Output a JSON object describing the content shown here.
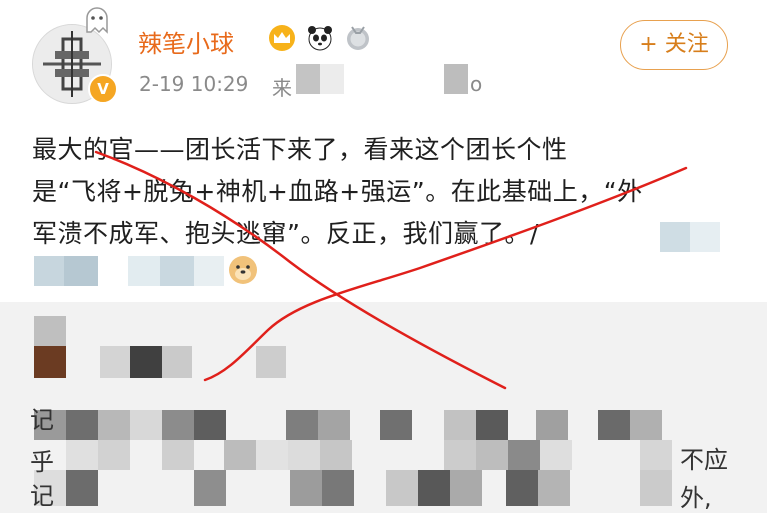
{
  "post": {
    "username": "辣笔小球",
    "timestamp": "2-19 10:29",
    "source_prefix": "来",
    "source_suffix": "o",
    "follow_label": "+ 关注",
    "content_lines": [
      "最大的官——团长活下来了，看来这个团长个性",
      "是“飞将+脱兔+神机+血路+强运”。在此基础上，“外",
      "军溃不成军、抱头逃窜”。反正，我们赢了。/"
    ],
    "verified_mark": "V"
  },
  "comment": {
    "edge_text_1": "不应",
    "edge_text_2": "外,",
    "edge_left_1": "记",
    "edge_left_2": "乎",
    "edge_left_3": "记"
  },
  "icons": [
    "ghost-icon",
    "crown-icon",
    "panda-icon",
    "medal-icon",
    "doge-emoji-icon",
    "verified-icon"
  ],
  "colors": {
    "username": "#e86a1b",
    "follow_border": "#e8a14f",
    "strike": "#e0201b"
  }
}
